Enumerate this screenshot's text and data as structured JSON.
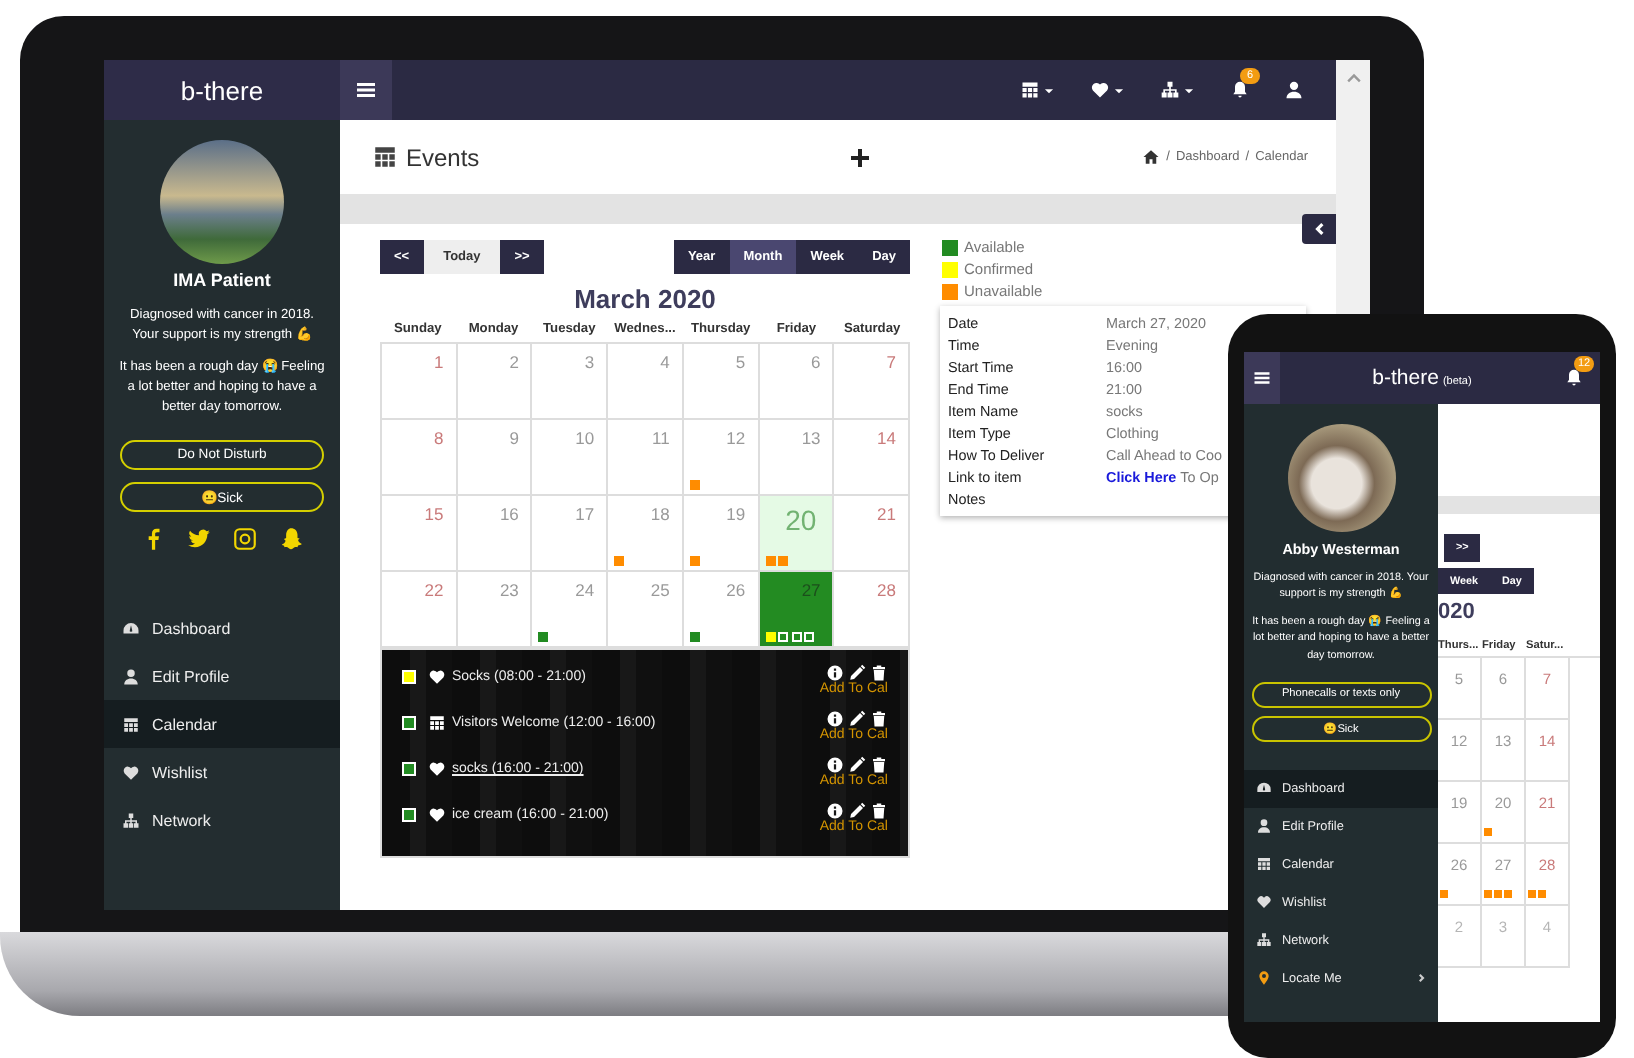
{
  "laptop": {
    "sidebar": {
      "brand": "b-there",
      "profile_name": "IMA Patient",
      "bio": [
        "Diagnosed with cancer in 2018. Your support is my strength 💪",
        "It has been a rough day 😭 Feeling a lot better and hoping to have a better day tomorrow."
      ],
      "status_buttons": [
        "Do Not Disturb",
        "😐Sick"
      ],
      "social": [
        {
          "kind": "facebook"
        },
        {
          "kind": "twitter"
        },
        {
          "kind": "instagram"
        },
        {
          "kind": "snapchat"
        }
      ],
      "nav": [
        {
          "label": "Dashboard",
          "kind": "dashboard",
          "selected": false
        },
        {
          "label": "Edit Profile",
          "kind": "user",
          "selected": false
        },
        {
          "label": "Calendar",
          "kind": "calendar",
          "selected": true
        },
        {
          "label": "Wishlist",
          "kind": "heart",
          "selected": false
        },
        {
          "label": "Network",
          "kind": "network",
          "selected": false
        }
      ]
    },
    "topbar": {
      "icons": [
        {
          "kind": "calendar",
          "caret": true
        },
        {
          "kind": "heart",
          "caret": true
        },
        {
          "kind": "network",
          "caret": true
        },
        {
          "kind": "bell",
          "caret": false,
          "badge": "6"
        },
        {
          "kind": "user",
          "caret": false
        }
      ]
    },
    "header": {
      "title": "Events",
      "breadcrumb": [
        {
          "separator": "/",
          "label": "Dashboard"
        },
        {
          "separator": "/",
          "label": "Calendar"
        }
      ]
    },
    "calendar": {
      "nav_buttons": [
        "<<",
        "Today",
        ">>"
      ],
      "view_buttons": [
        {
          "label": "Year",
          "selected": false
        },
        {
          "label": "Month",
          "selected": true
        },
        {
          "label": "Week",
          "selected": false
        },
        {
          "label": "Day",
          "selected": false
        }
      ],
      "title": "March 2020",
      "weekdays": [
        "Sunday",
        "Monday",
        "Tuesday",
        "Wednes...",
        "Thursday",
        "Friday",
        "Saturday"
      ],
      "weeks": [
        [
          {
            "day": "1",
            "today": false,
            "selected": false
          },
          {
            "day": "2",
            "today": false,
            "selected": false
          },
          {
            "day": "3",
            "today": false,
            "selected": false
          },
          {
            "day": "4",
            "today": false,
            "selected": false
          },
          {
            "day": "5",
            "today": false,
            "selected": false
          },
          {
            "day": "6",
            "today": false,
            "selected": false
          },
          {
            "day": "7",
            "today": false,
            "selected": false
          }
        ],
        [
          {
            "day": "8",
            "today": false,
            "selected": false
          },
          {
            "day": "9",
            "today": false,
            "selected": false
          },
          {
            "day": "10",
            "today": false,
            "selected": false
          },
          {
            "day": "11",
            "today": false,
            "selected": false
          },
          {
            "day": "12",
            "today": false,
            "selected": false,
            "dots": [
              {
                "kind": "filled",
                "color": "#ff8c00"
              }
            ]
          },
          {
            "day": "13",
            "today": false,
            "selected": false
          },
          {
            "day": "14",
            "today": false,
            "selected": false
          }
        ],
        [
          {
            "day": "15",
            "today": false,
            "selected": false
          },
          {
            "day": "16",
            "today": false,
            "selected": false
          },
          {
            "day": "17",
            "today": false,
            "selected": false
          },
          {
            "day": "18",
            "today": false,
            "selected": false,
            "dots": [
              {
                "kind": "filled",
                "color": "#ff8c00"
              }
            ]
          },
          {
            "day": "19",
            "today": false,
            "selected": false,
            "dots": [
              {
                "kind": "filled",
                "color": "#ff8c00"
              }
            ]
          },
          {
            "day": "20",
            "today": true,
            "selected": false,
            "dots": [
              {
                "kind": "filled",
                "color": "#ff8c00"
              },
              {
                "kind": "filled",
                "color": "#ff8c00"
              }
            ]
          },
          {
            "day": "21",
            "today": false,
            "selected": false
          }
        ],
        [
          {
            "day": "22",
            "today": false,
            "selected": false
          },
          {
            "day": "23",
            "today": false,
            "selected": false
          },
          {
            "day": "24",
            "today": false,
            "selected": false,
            "dots": [
              {
                "kind": "filled",
                "color": "#228b22"
              }
            ]
          },
          {
            "day": "25",
            "today": false,
            "selected": false
          },
          {
            "day": "26",
            "today": false,
            "selected": false,
            "dots": [
              {
                "kind": "filled",
                "color": "#228b22"
              }
            ]
          },
          {
            "day": "27",
            "today": false,
            "selected": true,
            "dots": [
              {
                "kind": "filled",
                "color": "#ffff00"
              },
              {
                "kind": "outline",
                "color": "#ffffff"
              },
              {
                "kind": "outline",
                "color": "#ffffff"
              },
              {
                "kind": "outline",
                "color": "#ffffff"
              }
            ]
          },
          {
            "day": "28",
            "today": false,
            "selected": false
          }
        ]
      ],
      "events": [
        {
          "color": "#ffff00",
          "kind": "heart",
          "text": "Socks (08:00 - 21:00)",
          "underlined": false,
          "action": "Add To Cal"
        },
        {
          "color": "#228b22",
          "kind": "calendar",
          "text": "Visitors Welcome (12:00 - 16:00)",
          "underlined": false,
          "action": "Add To Cal"
        },
        {
          "color": "#228b22",
          "kind": "heart",
          "text": "socks (16:00 - 21:00)",
          "underlined": true,
          "action": "Add To Cal"
        },
        {
          "color": "#228b22",
          "kind": "heart",
          "text": "ice cream (16:00 - 21:00)",
          "underlined": false,
          "action": "Add To Cal"
        }
      ]
    },
    "legend": [
      {
        "label": "Available",
        "color": "#228b22"
      },
      {
        "label": "Confirmed",
        "color": "#ffff00"
      },
      {
        "label": "Unavailable",
        "color": "#ff8c00"
      }
    ],
    "details": [
      {
        "label": "Date",
        "value": "March 27, 2020"
      },
      {
        "label": "Time",
        "value": "Evening"
      },
      {
        "label": "Start Time",
        "value": "16:00"
      },
      {
        "label": "End Time",
        "value": "21:00"
      },
      {
        "label": "Item Name",
        "value": "socks"
      },
      {
        "label": "Item Type",
        "value": "Clothing"
      },
      {
        "label": "How To Deliver",
        "value": "Call Ahead to Coo"
      },
      {
        "label": "Link to item",
        "link": "Click Here",
        "value": "To Op"
      },
      {
        "label": "Notes"
      }
    ]
  },
  "phone": {
    "topbar": {
      "brand": "b-there",
      "tag": "(beta)",
      "badge": "12"
    },
    "sidebar": {
      "profile_name": "Abby Westerman",
      "bio": [
        "Diagnosed with cancer in 2018. Your support is my strength 💪",
        "It has been a rough day 😭 Feeling a lot better and hoping to have a better day tomorrow."
      ],
      "status_buttons": [
        "Phonecalls or texts only",
        "😐Sick"
      ],
      "nav": [
        {
          "label": "Dashboard",
          "kind": "dashboard",
          "selected": true,
          "submenu": false
        },
        {
          "label": "Edit Profile",
          "kind": "user",
          "selected": false,
          "submenu": false
        },
        {
          "label": "Calendar",
          "kind": "calendar",
          "selected": false,
          "submenu": false
        },
        {
          "label": "Wishlist",
          "kind": "heart",
          "selected": false,
          "submenu": false
        },
        {
          "label": "Network",
          "kind": "network",
          "selected": false,
          "submenu": false
        },
        {
          "label": "Locate Me",
          "kind": "pin",
          "selected": false,
          "submenu": true
        }
      ]
    },
    "calendar": {
      "nav_button": ">>",
      "view_buttons": [
        {
          "label": "Week",
          "selected": false
        },
        {
          "label": "Day",
          "selected": false
        }
      ],
      "title": "020",
      "weekdays": [
        "Thurs...",
        "Friday",
        "Satur..."
      ],
      "weeks": [
        [
          {
            "day": "5",
            "outside": false
          },
          {
            "day": "6",
            "outside": false
          },
          {
            "day": "7",
            "outside": false
          }
        ],
        [
          {
            "day": "12",
            "outside": false
          },
          {
            "day": "13",
            "outside": false
          },
          {
            "day": "14",
            "outside": false
          }
        ],
        [
          {
            "day": "19",
            "outside": false
          },
          {
            "day": "20",
            "outside": false,
            "dots": [
              {
                "kind": "filled",
                "color": "#ff8c00"
              }
            ]
          },
          {
            "day": "21",
            "outside": false
          }
        ],
        [
          {
            "day": "26",
            "outside": false,
            "dots": [
              {
                "kind": "filled",
                "color": "#ff8c00"
              }
            ]
          },
          {
            "day": "27",
            "outside": false,
            "dots": [
              {
                "kind": "filled",
                "color": "#ff8c00"
              },
              {
                "kind": "filled",
                "color": "#ff8c00"
              },
              {
                "kind": "filled",
                "color": "#ff8c00"
              }
            ]
          },
          {
            "day": "28",
            "outside": false,
            "dots": [
              {
                "kind": "filled",
                "color": "#ff8c00"
              },
              {
                "kind": "filled",
                "color": "#ff8c00"
              }
            ]
          }
        ],
        [
          {
            "day": "2",
            "outside": true
          },
          {
            "day": "3",
            "outside": true
          },
          {
            "day": "4",
            "outside": true
          }
        ]
      ]
    }
  }
}
